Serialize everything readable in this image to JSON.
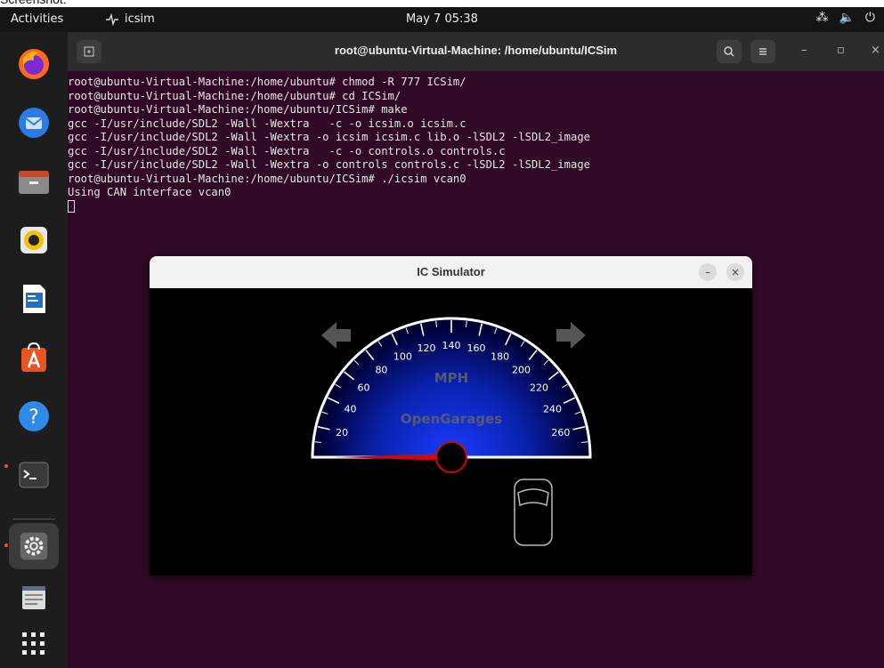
{
  "caption": "Screenshot:",
  "topbar": {
    "activities": "Activities",
    "app_name": "icsim",
    "clock": "May 7  05:38",
    "tray": {
      "network_icon": "network-icon",
      "volume_icon": "volume-icon",
      "power_icon": "power-icon"
    }
  },
  "dock": {
    "items": [
      "firefox",
      "thunderbird",
      "files",
      "rhythmbox",
      "libreoffice-writer",
      "ubuntu-software",
      "help",
      "terminal",
      "settings",
      "text-editor",
      "show-applications"
    ]
  },
  "terminal": {
    "title": "root@ubuntu-Virtual-Machine: /home/ubuntu/ICSim",
    "lines": [
      "root@ubuntu-Virtual-Machine:/home/ubuntu# chmod -R 777 ICSim/",
      "root@ubuntu-Virtual-Machine:/home/ubuntu# cd ICSim/",
      "root@ubuntu-Virtual-Machine:/home/ubuntu/ICSim# make",
      "gcc -I/usr/include/SDL2 -Wall -Wextra   -c -o icsim.o icsim.c",
      "gcc -I/usr/include/SDL2 -Wall -Wextra -o icsim icsim.c lib.o -lSDL2 -lSDL2_image",
      "gcc -I/usr/include/SDL2 -Wall -Wextra   -c -o controls.o controls.c",
      "gcc -I/usr/include/SDL2 -Wall -Wextra -o controls controls.c -lSDL2 -lSDL2_image",
      "root@ubuntu-Virtual-Machine:/home/ubuntu/ICSim# ./icsim vcan0",
      "Using CAN interface vcan0"
    ]
  },
  "icsim": {
    "title": "IC Simulator",
    "gauge": {
      "unit": "MPH",
      "brand": "OpenGarages",
      "ticks": [
        "20",
        "40",
        "60",
        "80",
        "100",
        "120",
        "140",
        "160",
        "180",
        "200",
        "220",
        "240",
        "260"
      ],
      "speed": 0
    },
    "colors": {
      "gauge_center": "#1a3cff",
      "gauge_edge": "#000033",
      "needle": "#cc0a0a",
      "arrow": "#555555",
      "text": "#555a70"
    }
  }
}
